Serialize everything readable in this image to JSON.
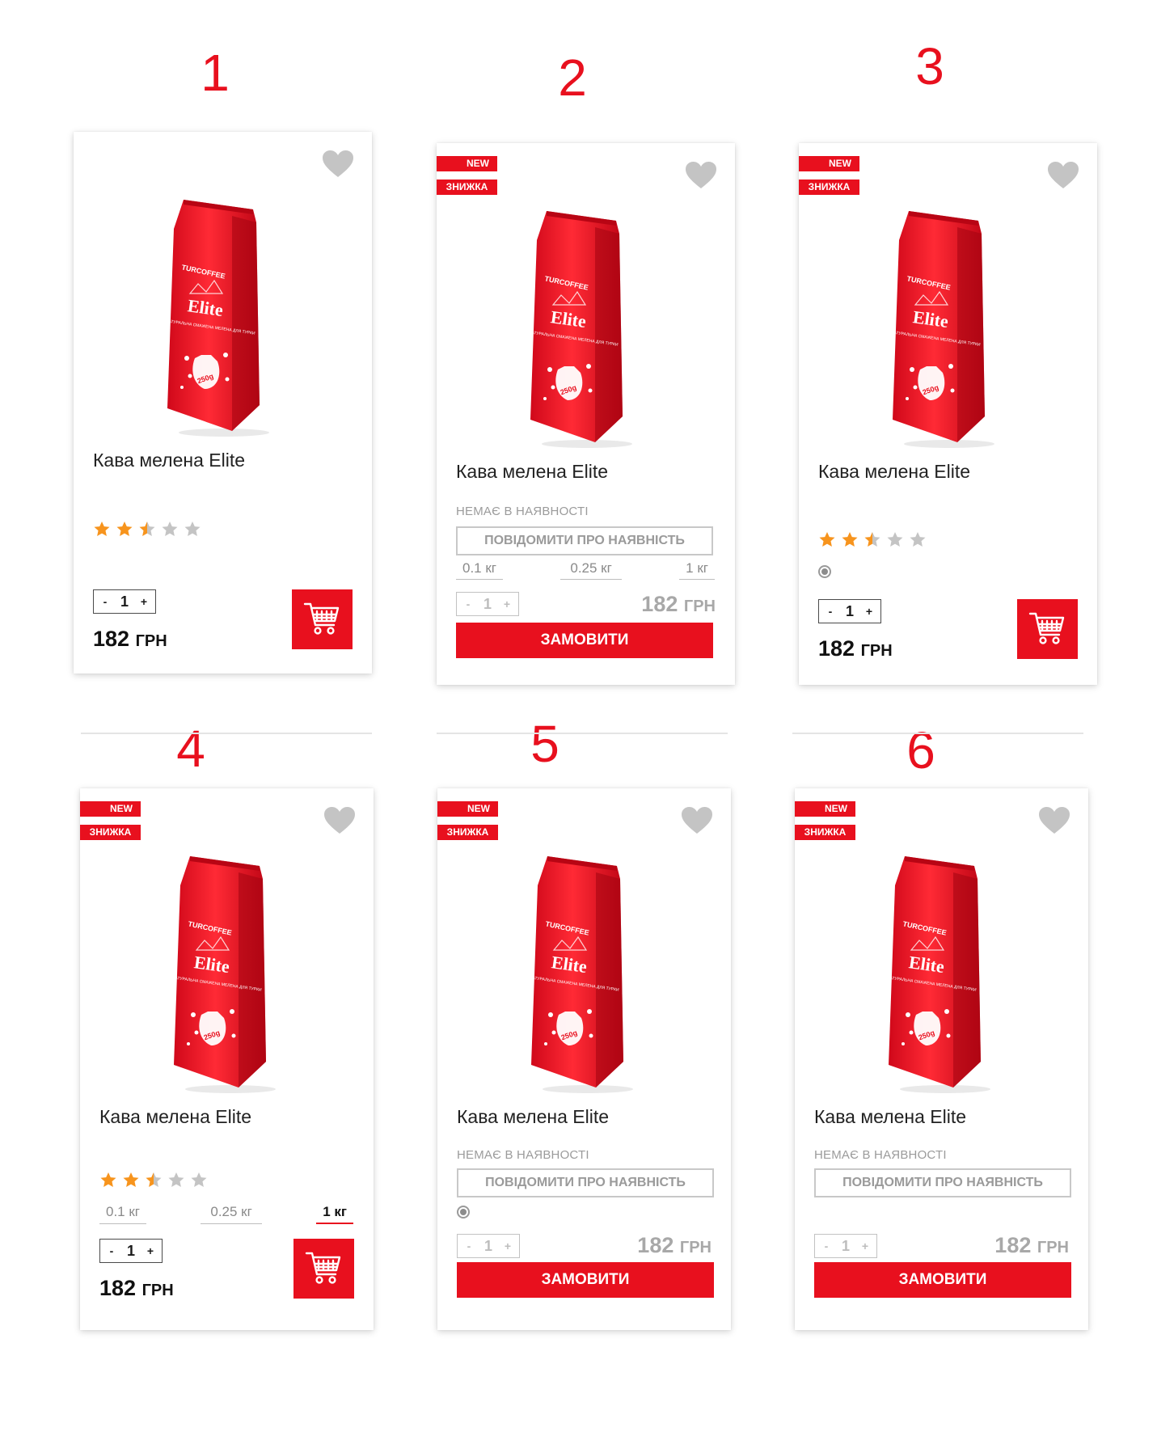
{
  "labels": [
    "1",
    "2",
    "3",
    "4",
    "5",
    "6"
  ],
  "product": {
    "title": "Кава мелена Elite",
    "brand": "TURCOFFEE",
    "name": "Elite",
    "pack_subtitle": "КАВА НАТУРАЛЬНА СМАЖЕНА МЕЛЕНА ДЛЯ ТУРКИ",
    "pack_weight": "250g",
    "price_value": "182",
    "price_currency": "ГРН",
    "rating": 2.5,
    "qty": "1",
    "minus": "-",
    "plus": "+"
  },
  "badges": {
    "new": "NEW",
    "sale": "ЗНИЖКА"
  },
  "stock_out": "НЕМАЄ В НАЯВНОСТІ",
  "notify_label": "ПОВІДОМИТИ ПРО НАЯВНІСТЬ",
  "order_label": "ЗАМОВИТИ",
  "weights": [
    "0.1 кг",
    "0.25 кг",
    "1 кг"
  ],
  "selected_weight_card4": "1 кг",
  "colors": {
    "accent": "#e8101e",
    "star_filled": "#f7941d",
    "star_empty": "#c4c4c4",
    "heart": "#c4c4c4"
  },
  "icons": {
    "favorite": "heart-icon",
    "cart": "cart-icon",
    "star": "star-icon"
  }
}
